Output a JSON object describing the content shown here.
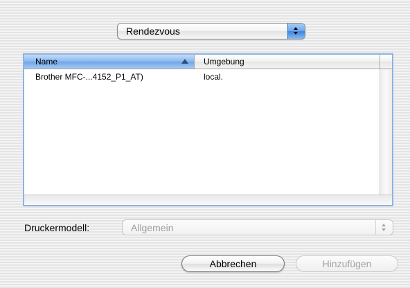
{
  "source_popup": {
    "selected": "Rendezvous"
  },
  "printer_table": {
    "columns": [
      {
        "label": "Name",
        "sort": "ascending"
      },
      {
        "label": "Umgebung"
      }
    ],
    "rows": [
      {
        "name": "Brother MFC-...4152_P1_AT)",
        "environment": "local."
      }
    ]
  },
  "printer_model": {
    "label": "Druckermodell:",
    "selected": "Allgemein",
    "enabled": false
  },
  "buttons": {
    "cancel": "Abbrechen",
    "add": "Hinzufügen",
    "add_enabled": false
  },
  "colors": {
    "selection_blue": "#6ea5e8",
    "table_focus_border": "#8db3e3",
    "disabled_text": "#9d9d9d"
  }
}
